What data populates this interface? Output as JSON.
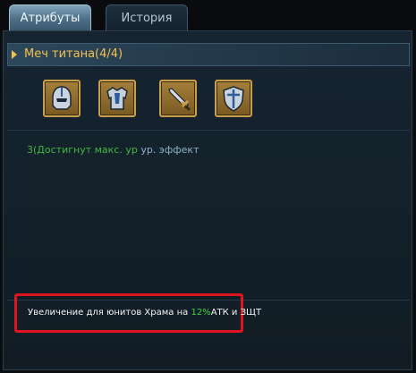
{
  "tabs": [
    {
      "label": "Атрибуты",
      "active": true
    },
    {
      "label": "История",
      "active": false
    }
  ],
  "set": {
    "title": "Меч титана(4/4)",
    "items": [
      {
        "icon": "helmet-icon"
      },
      {
        "icon": "armor-icon"
      },
      {
        "icon": "sword-icon"
      },
      {
        "icon": "shield-icon"
      }
    ]
  },
  "effect": {
    "green_part": "3(Достигнут макс. ур",
    "blue_part": " ур. эффект"
  },
  "bonus": {
    "prefix": "Увеличение для юнитов Храма на ",
    "percent": "12%",
    "suffix": "АТК и ЗЩТ"
  },
  "colors": {
    "title": "#f2c14e",
    "effect_green": "#3fb83f",
    "effect_blue": "#8fb3c9",
    "highlight_border": "#e0141c"
  }
}
